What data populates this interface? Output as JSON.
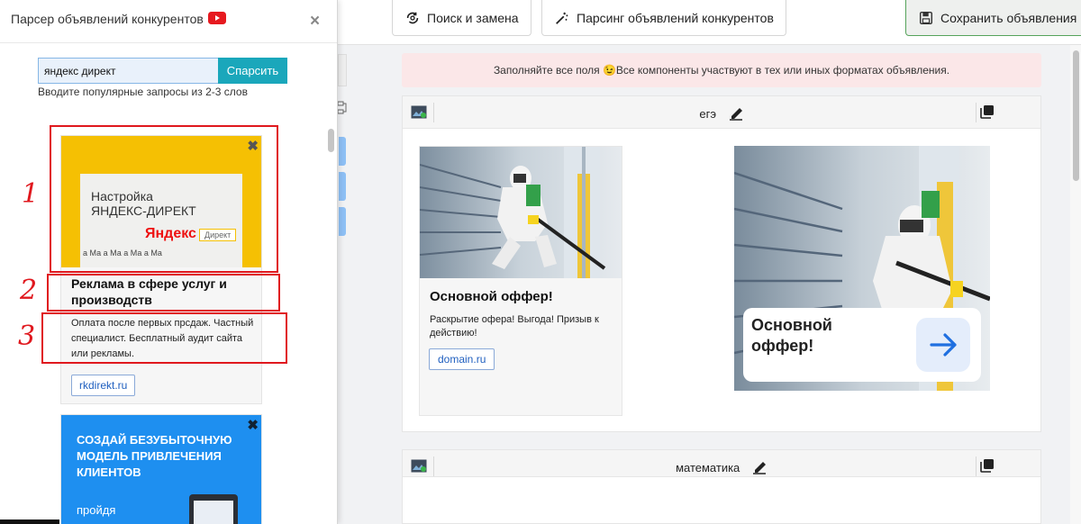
{
  "toolbar": {
    "search_replace": "Поиск и замена",
    "parse_ads": "Парсинг объявлений конкурентов",
    "save_ads": "Сохранить объявления"
  },
  "notice": "Заполняйте все поля 😉Все компоненты участвуют в тех или иных форматах объявления.",
  "cards": [
    {
      "title": "егэ",
      "ad_text": {
        "headline": "Основной оффер!",
        "description": "Раскрытие офера! Выгода! Призыв к действию!",
        "domain": "domain.ru"
      },
      "ad_image": {
        "headline": "Основной оффер!"
      }
    },
    {
      "title": "математика"
    }
  ],
  "panel": {
    "title": "Парсер объявлений конкурентов",
    "close": "×",
    "search_value": "яндекс директ",
    "search_button": "Спарсить",
    "hint": "Вводите популярные запросы из 2-3 слов",
    "results": [
      {
        "banner_line1": "Настройка",
        "banner_line2": "ЯНДЕКС-ДИРЕКТ",
        "banner_brand": "Яндекс",
        "banner_tag": "Директ",
        "banner_stack": "а Ма   а Ма   а Ма   а Ма",
        "title": "Реклама в сфере услуг и производств",
        "description": "Оплата после первых прсдаж. Частный специалист. Бесплатный аудит сайта или рекламы.",
        "link": "rkdirekt.ru"
      },
      {
        "banner_text": "СОЗДАЙ БЕЗУБЫТОЧНУЮ МОДЕЛЬ ПРИВЛЕЧЕНИЯ КЛИЕНТОВ",
        "banner_sub": "пройдя"
      }
    ]
  },
  "annotations": [
    "1",
    "2",
    "3"
  ],
  "colors": {
    "accent": "#1aa7bb",
    "annotation": "#e0181e",
    "notice_bg": "#fbe7e8",
    "yellow_banner": "#f5c003",
    "blue_banner": "#1e8ff0"
  }
}
